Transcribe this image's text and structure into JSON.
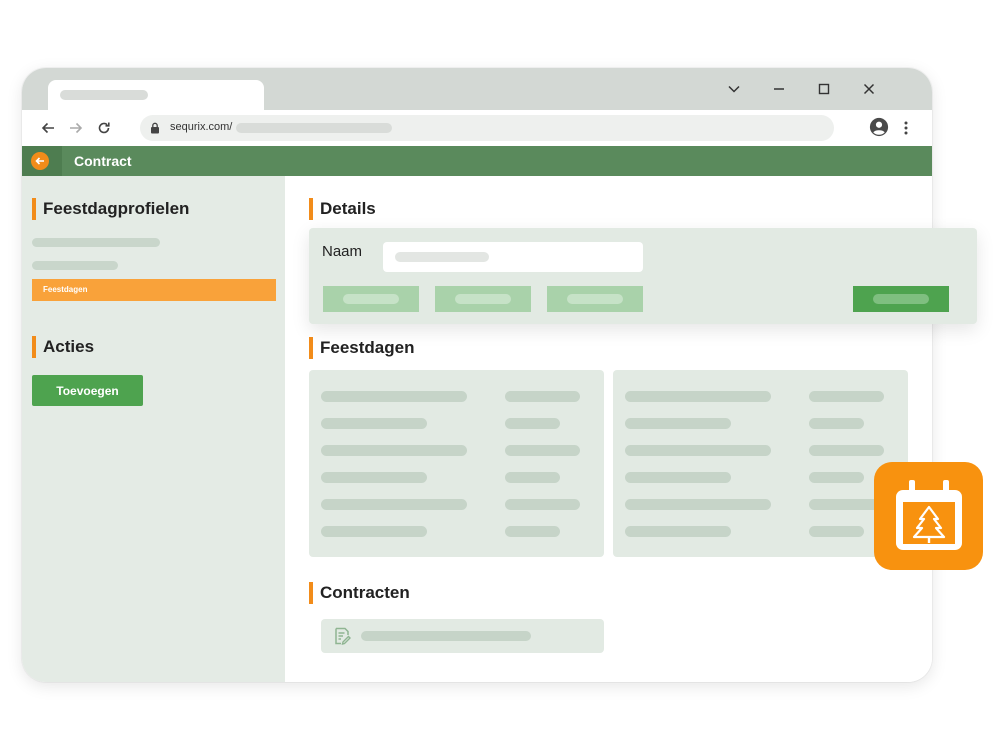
{
  "browser": {
    "url": "sequrix.com/",
    "icons": [
      "chevron-down-icon",
      "minimize-icon",
      "maximize-icon",
      "close-icon",
      "back-arrow-icon",
      "forward-arrow-icon",
      "reload-icon",
      "lock-icon",
      "account-icon",
      "more-vertical-icon"
    ]
  },
  "app": {
    "title": "Contract",
    "accent": "#f28c1a",
    "header_color": "#5a8a5c"
  },
  "sidebar": {
    "profiles_title": "Feestdagprofielen",
    "active_item": "Feestdagen",
    "actions_title": "Acties",
    "add_button": "Toevoegen"
  },
  "details": {
    "title": "Details",
    "name_label": "Naam"
  },
  "holidays": {
    "title": "Feestdagen"
  },
  "contracts": {
    "title": "Contracten"
  },
  "badge": {
    "icon": "calendar-tree-icon",
    "color": "#f8920f"
  }
}
